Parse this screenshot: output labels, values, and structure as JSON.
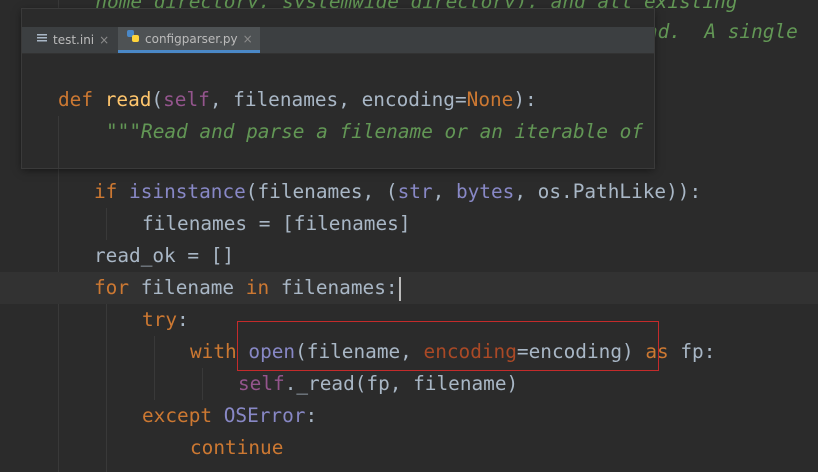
{
  "code": {
    "bg_line_1": "home directory, systemwide directory), and all existing",
    "bg_line_2_tail": "nd.  A single",
    "line_if": [
      "if",
      " ",
      "isinstance",
      "(filenames, (",
      "str",
      ", ",
      "bytes",
      ", os.PathLike)):"
    ],
    "line_assign": "filenames = [filenames]",
    "line_readok": "read_ok = []",
    "line_for": [
      "for",
      " filename ",
      "in",
      " filenames:"
    ],
    "line_try": [
      "try",
      ":"
    ],
    "line_with": [
      "with",
      " ",
      "open",
      "(filename, ",
      "encoding",
      "=encoding) ",
      "as",
      " fp:"
    ],
    "line_read": [
      "self",
      "._read(fp, filename)"
    ],
    "line_except": [
      "except",
      " ",
      "OSError",
      ":"
    ],
    "line_continue": "continue"
  },
  "popup": {
    "tabs": [
      {
        "label": "test.ini",
        "icon": "text-file-icon",
        "close": "×"
      },
      {
        "label": "configparser.py",
        "icon": "python-file-icon",
        "close": "×"
      }
    ],
    "def_line": [
      "def",
      " ",
      "read",
      "(",
      "self",
      ", filenames, encoding=",
      "None",
      "):"
    ],
    "doc_line": "\"\"\"Read and parse a filename or an iterable of"
  }
}
